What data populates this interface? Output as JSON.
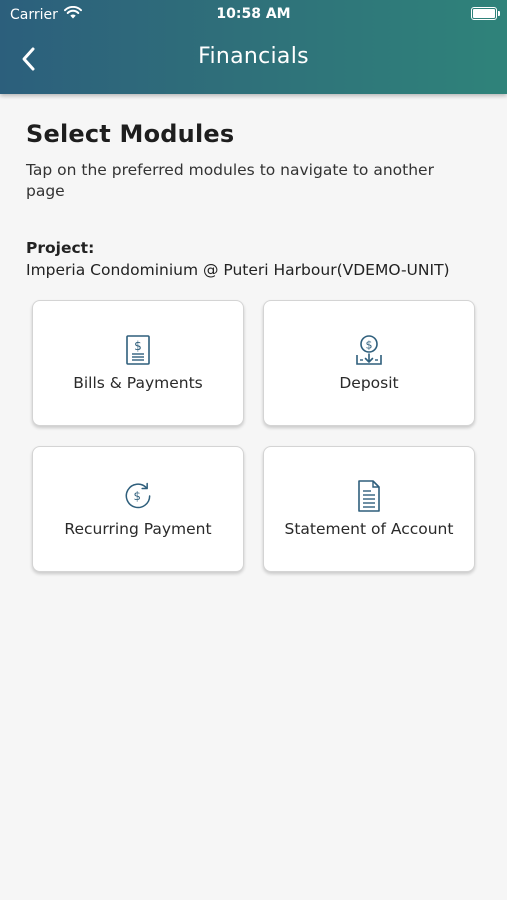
{
  "status_bar": {
    "carrier": "Carrier",
    "time": "10:58 AM",
    "battery_level": 1.0
  },
  "header": {
    "title": "Financials",
    "back_icon": "chevron-left-icon"
  },
  "main": {
    "heading": "Select Modules",
    "subheading": "Tap on the preferred modules to navigate to another page",
    "project_label": "Project:",
    "project_value": "Imperia Condominium @ Puteri Harbour(VDEMO-UNIT)"
  },
  "modules": [
    {
      "label": "Bills & Payments",
      "icon": "bill-icon"
    },
    {
      "label": "Deposit",
      "icon": "deposit-icon"
    },
    {
      "label": "Recurring Payment",
      "icon": "recurring-payment-icon"
    },
    {
      "label": "Statement of Account",
      "icon": "statement-icon"
    }
  ],
  "colors": {
    "header_start": "#2c5f7c",
    "header_end": "#2f837a",
    "icon": "#2f5f7c",
    "background": "#f6f6f6"
  }
}
